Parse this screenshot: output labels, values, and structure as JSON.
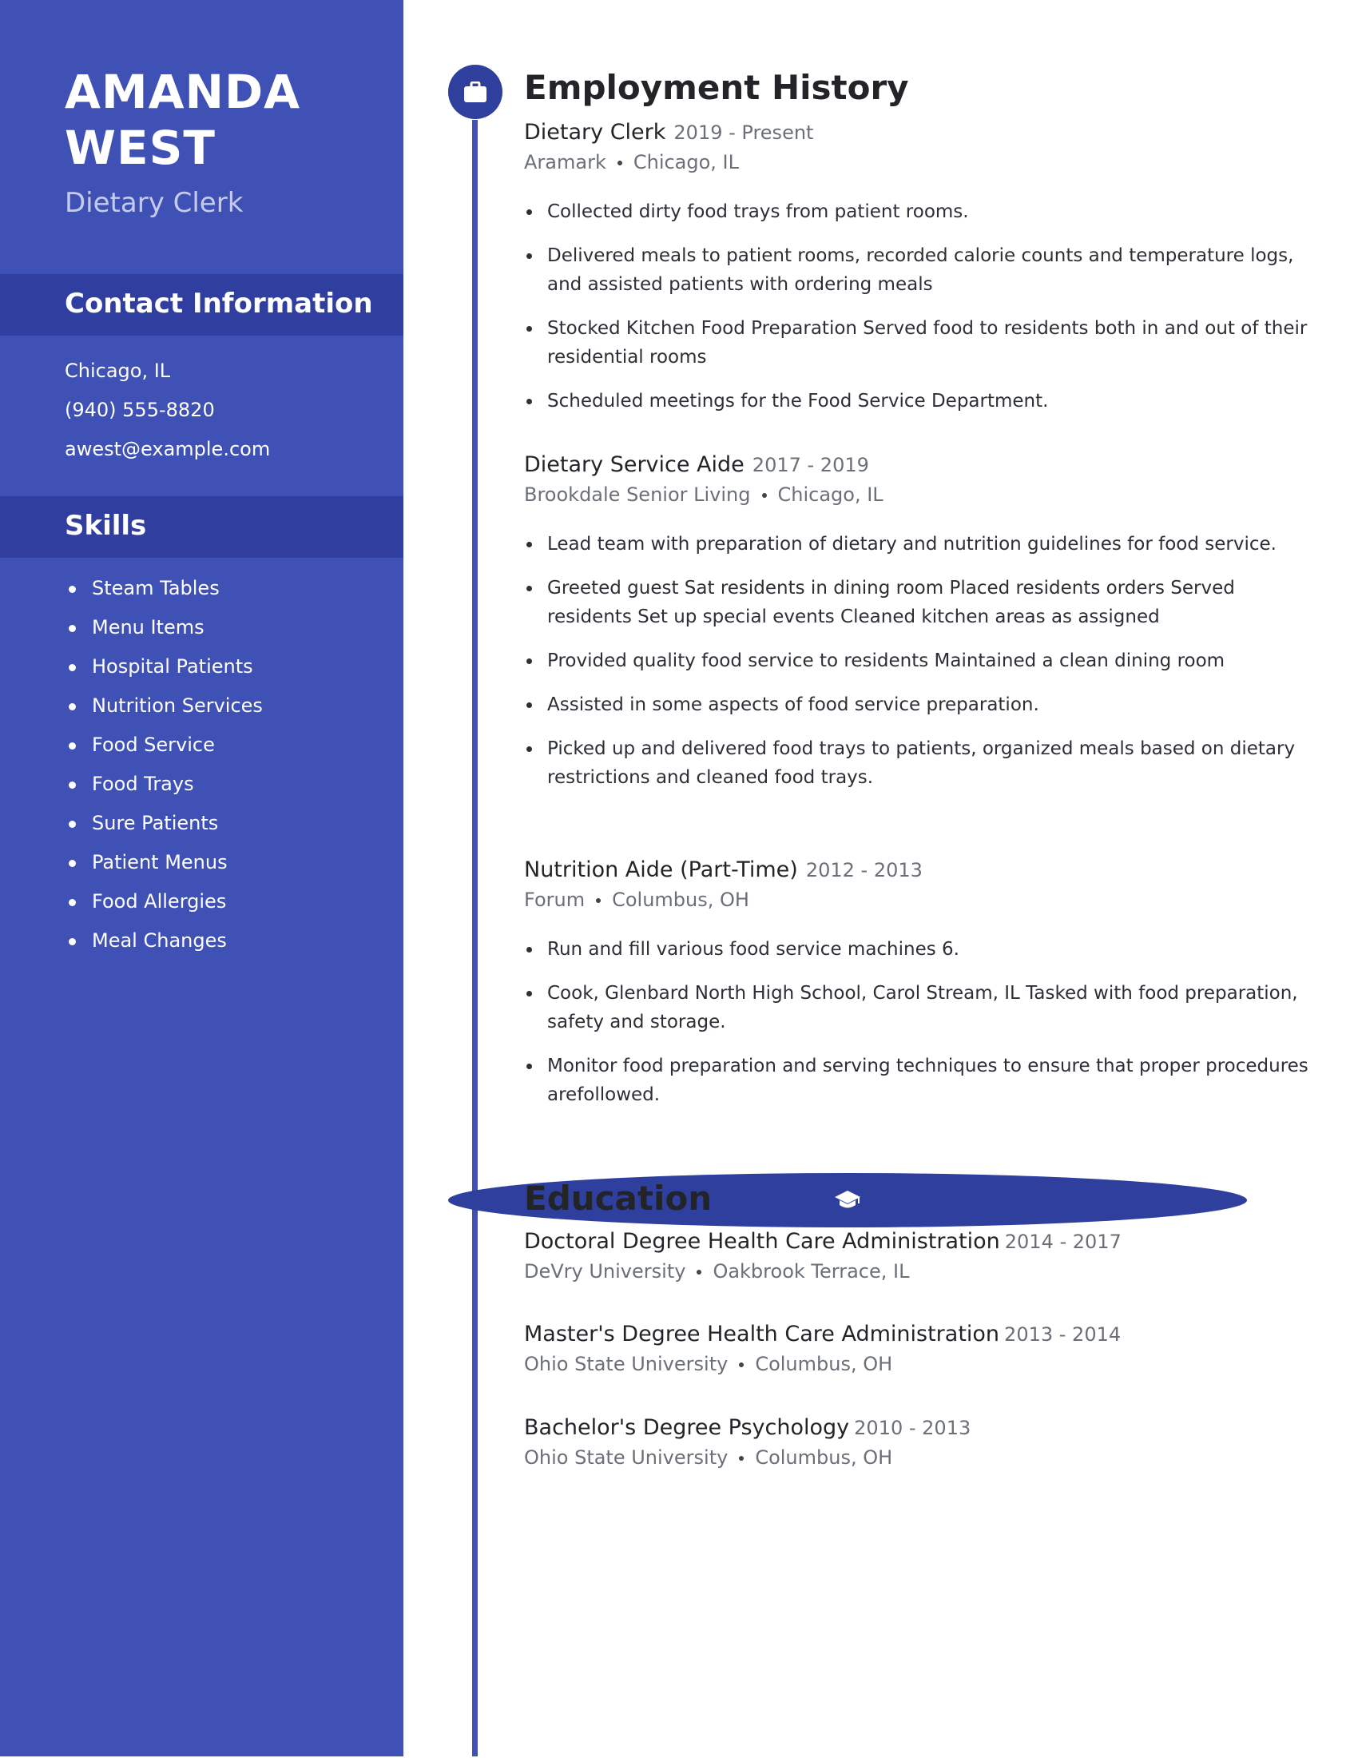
{
  "profile": {
    "first_name": "AMANDA",
    "last_name": "WEST",
    "headline": "Dietary Clerk"
  },
  "contact": {
    "heading": "Contact Information",
    "items": [
      "Chicago, IL",
      "(940) 555-8820",
      "awest@example.com"
    ]
  },
  "skills": {
    "heading": "Skills",
    "items": [
      "Steam Tables",
      "Menu Items",
      "Hospital Patients",
      "Nutrition Services",
      "Food Service",
      "Food Trays",
      "Sure Patients",
      "Patient Menus",
      "Food Allergies",
      "Meal Changes"
    ]
  },
  "employment": {
    "heading": "Employment History",
    "icon": "briefcase-icon",
    "jobs": [
      {
        "title": "Dietary Clerk",
        "dates": "2019 - Present",
        "employer": "Aramark",
        "location": "Chicago, IL",
        "bullets": [
          "Collected dirty food trays from patient rooms.",
          "Delivered meals to patient rooms, recorded calorie counts and temperature logs, and assisted patients with ordering meals",
          "Stocked Kitchen Food Preparation Served food to residents both in and out of their residential rooms",
          "Scheduled meetings for the Food Service Department."
        ]
      },
      {
        "title": "Dietary Service Aide",
        "dates": "2017 - 2019",
        "employer": "Brookdale Senior Living",
        "location": "Chicago, IL",
        "bullets": [
          "Lead team with preparation of dietary and nutrition guidelines for food service.",
          "Greeted guest Sat residents in dining room Placed residents orders Served residents Set up special events Cleaned kitchen areas as assigned",
          "Provided quality food service to residents Maintained a clean dining room",
          "Assisted in some aspects of food service preparation.",
          "Picked up and delivered food trays to patients, organized meals based on dietary restrictions and cleaned food trays."
        ]
      },
      {
        "title": "Nutrition Aide (Part-Time)",
        "dates": "2012 - 2013",
        "employer": "Forum",
        "location": "Columbus, OH",
        "bullets": [
          "Run and fill various food service machines 6.",
          "Cook, Glenbard North High School, Carol Stream, IL Tasked with food preparation, safety and storage.",
          "Monitor food preparation and serving techniques to ensure that proper procedures arefollowed."
        ]
      }
    ]
  },
  "education": {
    "heading": "Education",
    "icon": "graduation-cap-icon",
    "entries": [
      {
        "degree": "Doctoral Degree Health Care Administration",
        "dates": "2014 - 2017",
        "school": "DeVry University",
        "location": "Oakbrook Terrace, IL"
      },
      {
        "degree": "Master's Degree Health Care Administration",
        "dates": "2013 - 2014",
        "school": "Ohio State University",
        "location": "Columbus, OH"
      },
      {
        "degree": "Bachelor's Degree Psychology",
        "dates": "2010 - 2013",
        "school": "Ohio State University",
        "location": "Columbus, OH"
      }
    ]
  },
  "colors": {
    "sidebar": "#3f51b5",
    "sidebar_band": "#303f9f",
    "timeline_circle": "#2f3f9e",
    "headline_text": "#c5cbee",
    "body_text": "#222428",
    "muted_text": "#6b6f78"
  }
}
